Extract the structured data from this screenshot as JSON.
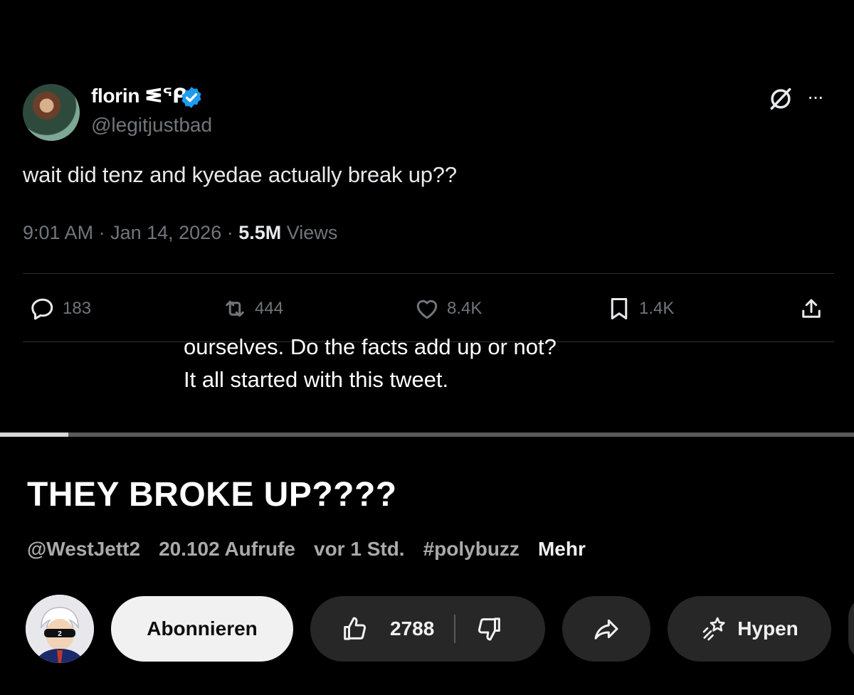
{
  "tweet": {
    "display_name": "florin ᓬᕿ",
    "handle": "@legitjustbad",
    "text": "wait did tenz and kyedae actually break up??",
    "time": "9:01 AM",
    "date": "Jan 14, 2026",
    "views_count": "5.5M",
    "views_label": "Views",
    "replies": "183",
    "reposts": "444",
    "likes": "8.4K",
    "bookmarks": "1.4K"
  },
  "subtitles": {
    "line1": "ourselves. Do the facts add up or not?",
    "line2": "It all started with this tweet."
  },
  "player": {
    "progress_fraction": 0.08
  },
  "video": {
    "title": "THEY BROKE UP????",
    "channel": "@WestJett2",
    "views": "20.102 Aufrufe",
    "age": "vor 1 Std.",
    "hashtag": "#polybuzz",
    "more": "Mehr"
  },
  "actions": {
    "subscribe": "Abonnieren",
    "like_count": "2788",
    "hype": "Hypen"
  },
  "colors": {
    "background": "#000000",
    "verified_blue": "#1d9bf0",
    "muted_text": "#71767b",
    "pill_bg": "#272727"
  }
}
